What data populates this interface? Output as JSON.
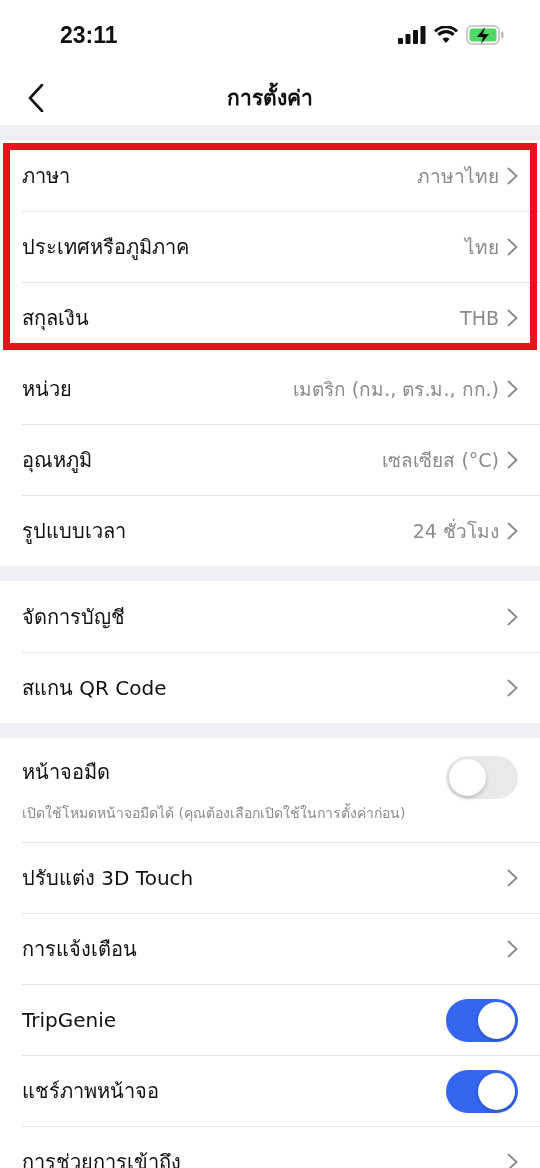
{
  "status_bar": {
    "time": "23:11",
    "battery_charging": true
  },
  "nav": {
    "title": "การตั้งค่า"
  },
  "sections": [
    {
      "highlighted": true,
      "rows": [
        {
          "kind": "link",
          "label": "ภาษา",
          "value": "ภาษาไทย"
        },
        {
          "kind": "link",
          "label": "ประเทศหรือภูมิภาค",
          "value": "ไทย"
        },
        {
          "kind": "link",
          "label": "สกุลเงิน",
          "value": "THB"
        }
      ]
    },
    {
      "highlighted": false,
      "rows": [
        {
          "kind": "link",
          "label": "หน่วย",
          "value": "เมตริก (กม., ตร.ม., กก.)"
        },
        {
          "kind": "link",
          "label": "อุณหภูมิ",
          "value": "เซลเซียส (°C)"
        },
        {
          "kind": "link",
          "label": "รูปแบบเวลา",
          "value": "24 ชั่วโมง"
        }
      ]
    },
    {
      "highlighted": false,
      "rows": [
        {
          "kind": "link",
          "label": "จัดการบัญชี"
        },
        {
          "kind": "link",
          "label": "สแกน QR Code"
        }
      ]
    },
    {
      "highlighted": false,
      "rows": [
        {
          "kind": "toggle",
          "label": "หน้าจอมืด",
          "description": "เปิดใช้โหมดหน้าจอมืดได้ (คุณต้องเลือกเปิดใช้ในการตั้งค่าก่อน)",
          "on": false
        },
        {
          "kind": "link",
          "label": "ปรับแต่ง 3D Touch"
        },
        {
          "kind": "link",
          "label": "การแจ้งเตือน"
        },
        {
          "kind": "toggle",
          "label": "TripGenie",
          "on": true
        },
        {
          "kind": "toggle",
          "label": "แชร์ภาพหน้าจอ",
          "on": true
        },
        {
          "kind": "link",
          "label": "การช่วยการเข้าถึง"
        }
      ]
    }
  ]
}
